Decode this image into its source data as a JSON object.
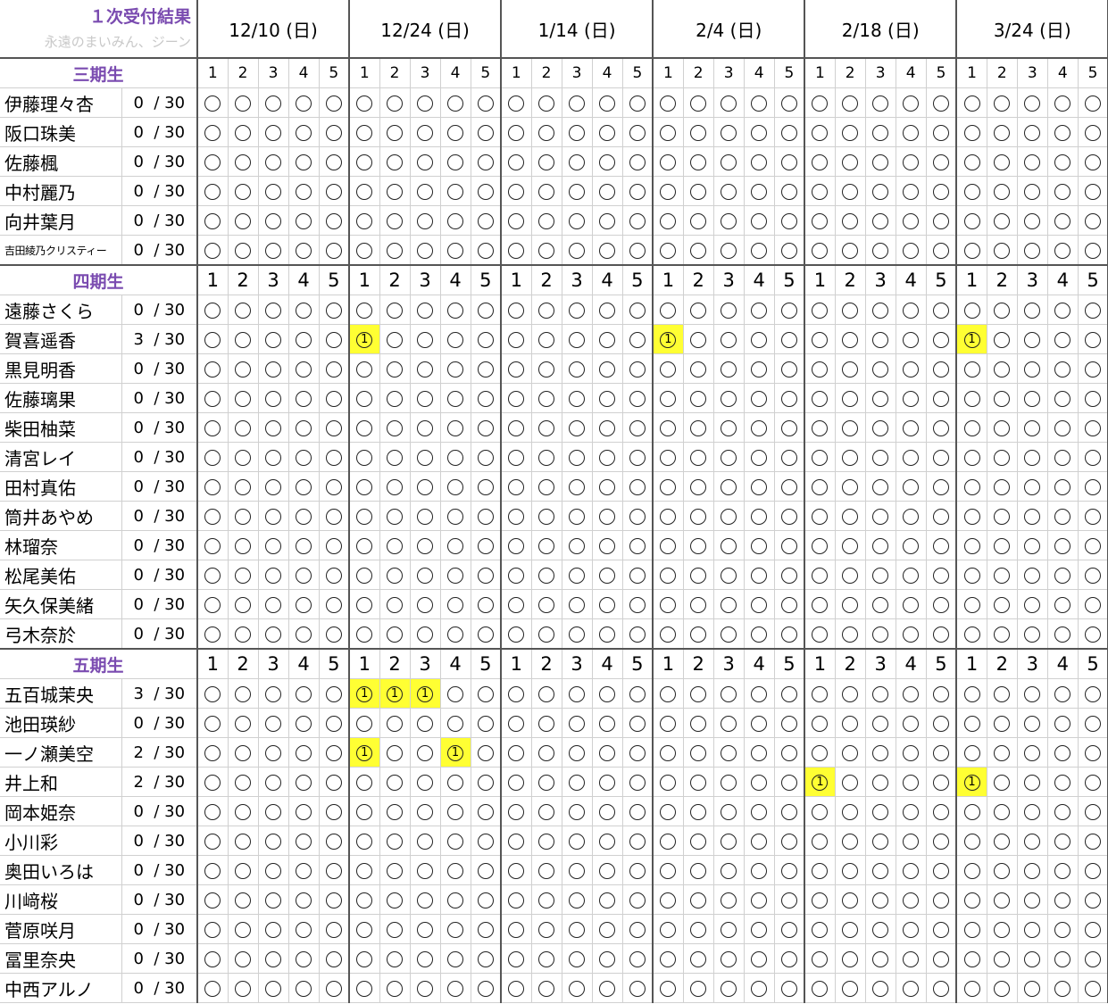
{
  "title": "１次受付結果",
  "subtitle": "永遠のまいみん、ジーン",
  "dates": [
    "12/10 (日)",
    "12/24 (日)",
    "1/14 (日)",
    "2/4 (日)",
    "2/18 (日)",
    "3/24 (日)"
  ],
  "slot_labels": [
    "1",
    "2",
    "3",
    "4",
    "5"
  ],
  "win_mark": "1",
  "score_format": "/ 30",
  "generations": [
    {
      "label": "三期生",
      "members": [
        {
          "name": "伊藤理々杏",
          "score": "0",
          "wins": []
        },
        {
          "name": "阪口珠美",
          "score": "0",
          "wins": []
        },
        {
          "name": "佐藤楓",
          "score": "0",
          "wins": []
        },
        {
          "name": "中村麗乃",
          "score": "0",
          "wins": []
        },
        {
          "name": "向井葉月",
          "score": "0",
          "wins": []
        },
        {
          "name": "吉田綾乃クリスティー",
          "score": "0",
          "wins": [],
          "small": true
        }
      ]
    },
    {
      "label": "四期生",
      "members": [
        {
          "name": "遠藤さくら",
          "score": "0",
          "wins": []
        },
        {
          "name": "賀喜遥香",
          "score": "3",
          "wins": [
            5,
            15,
            25
          ]
        },
        {
          "name": "黒見明香",
          "score": "0",
          "wins": []
        },
        {
          "name": "佐藤璃果",
          "score": "0",
          "wins": []
        },
        {
          "name": "柴田柚菜",
          "score": "0",
          "wins": []
        },
        {
          "name": "清宮レイ",
          "score": "0",
          "wins": []
        },
        {
          "name": "田村真佑",
          "score": "0",
          "wins": []
        },
        {
          "name": "筒井あやめ",
          "score": "0",
          "wins": []
        },
        {
          "name": "林瑠奈",
          "score": "0",
          "wins": []
        },
        {
          "name": "松尾美佑",
          "score": "0",
          "wins": []
        },
        {
          "name": "矢久保美緒",
          "score": "0",
          "wins": []
        },
        {
          "name": "弓木奈於",
          "score": "0",
          "wins": []
        }
      ]
    },
    {
      "label": "五期生",
      "members": [
        {
          "name": "五百城茉央",
          "score": "3",
          "wins": [
            5,
            6,
            7
          ]
        },
        {
          "name": "池田瑛紗",
          "score": "0",
          "wins": []
        },
        {
          "name": "一ノ瀬美空",
          "score": "2",
          "wins": [
            5,
            8
          ]
        },
        {
          "name": "井上和",
          "score": "2",
          "wins": [
            20,
            25
          ]
        },
        {
          "name": "岡本姫奈",
          "score": "0",
          "wins": []
        },
        {
          "name": "小川彩",
          "score": "0",
          "wins": []
        },
        {
          "name": "奥田いろは",
          "score": "0",
          "wins": []
        },
        {
          "name": "川﨑桜",
          "score": "0",
          "wins": []
        },
        {
          "name": "菅原咲月",
          "score": "0",
          "wins": []
        },
        {
          "name": "冨里奈央",
          "score": "0",
          "wins": []
        },
        {
          "name": "中西アルノ",
          "score": "0",
          "wins": []
        }
      ]
    }
  ],
  "colors": {
    "accent": "#7a4bb0",
    "highlight": "#ffff33",
    "subtitle": "#c8c8c8"
  }
}
